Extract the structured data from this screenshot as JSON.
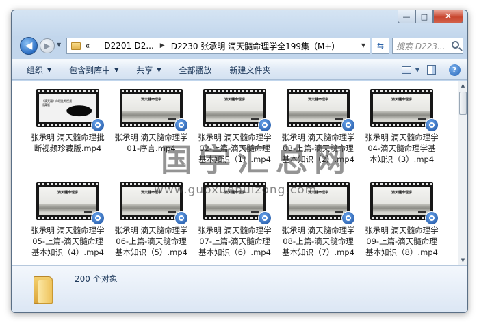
{
  "window": {
    "caption": {
      "minimize": "—",
      "maximize": "□",
      "close": "✕"
    }
  },
  "nav": {
    "back_glyph": "◀",
    "forward_glyph": "▶",
    "address": {
      "overflow": "«",
      "segments": [
        "D2201-D2...",
        "D2230 张承明 滴天髓命理学全199集（M+）"
      ]
    },
    "refresh_glyph": "⇆",
    "search_placeholder": "搜索 D223..."
  },
  "toolbar": {
    "items": [
      {
        "label": "组织",
        "has_arrow": true
      },
      {
        "label": "包含到库中",
        "has_arrow": true
      },
      {
        "label": "共享",
        "has_arrow": true
      },
      {
        "label": "全部播放",
        "has_arrow": false
      },
      {
        "label": "新建文件夹",
        "has_arrow": false
      }
    ],
    "help_glyph": "?"
  },
  "files": [
    {
      "name": "张承明 滴天髓命理批断视频珍藏版.mp4",
      "thumb": "dark",
      "frame_text": "《滴天髓》命理批断视频珍藏版"
    },
    {
      "name": "张承明 滴天髓命理学01-序言.mp4",
      "thumb": "light",
      "frame_text": "滴天髓命理学"
    },
    {
      "name": "张承明 滴天髓命理学02-上篇-滴天髓命理基本知识（1）.mp4",
      "thumb": "light",
      "frame_text": "滴天髓命理学"
    },
    {
      "name": "张承明 滴天髓命理学03-上篇-滴天髓命理基本知识（2）.mp4",
      "thumb": "light",
      "frame_text": "滴天髓命理学"
    },
    {
      "name": "张承明 滴天髓命理学04-滴天髓命理学基本知识（3）.mp4",
      "thumb": "light",
      "frame_text": "滴天髓命理学"
    },
    {
      "name": "张承明 滴天髓命理学05-上篇-滴天髓命理基本知识（4）.mp4",
      "thumb": "light",
      "frame_text": "滴天髓命理学"
    },
    {
      "name": "张承明 滴天髓命理学06-上篇-滴天髓命理基本知识（5）.mp4",
      "thumb": "light",
      "frame_text": "滴天髓命理学"
    },
    {
      "name": "张承明 滴天髓命理学07-上篇-滴天髓命理基本知识（6）.mp4",
      "thumb": "light",
      "frame_text": "滴天髓命理学"
    },
    {
      "name": "张承明 滴天髓命理学08-上篇-滴天髓命理基本知识（7）.mp4",
      "thumb": "light",
      "frame_text": "滴天髓命理学"
    },
    {
      "name": "张承明 滴天髓命理学09-上篇-滴天髓命理基本知识（8）.mp4",
      "thumb": "light",
      "frame_text": "滴天髓命理学"
    }
  ],
  "watermark": {
    "text": "国学汇总网",
    "url": "www.guoxuehuizong.com"
  },
  "details": {
    "count_text": "200 个对象"
  }
}
